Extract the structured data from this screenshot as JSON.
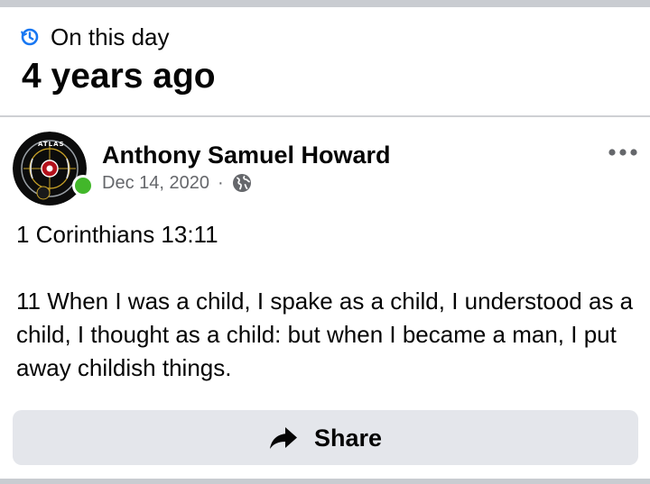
{
  "memory": {
    "label": "On this day",
    "years_ago": "4 years ago"
  },
  "post": {
    "author": "Anthony Samuel Howard",
    "date": "Dec 14, 2020",
    "separator": "·",
    "privacy_icon": "globe-icon",
    "online_status_color": "#42b72a",
    "avatar_text": "ATLAS",
    "body_lines": [
      "1 Corinthians 13:11",
      "",
      "11 When I was a child, I spake as a child, I understood as a child, I thought as a child: but when I became a man, I put away childish things."
    ]
  },
  "actions": {
    "more_icon": "more-options-icon",
    "share_label": "Share",
    "share_icon": "share-arrow-icon"
  },
  "colors": {
    "accent_blue": "#1877f2",
    "secondary_text": "#65676b",
    "button_bg": "#e4e6eb",
    "divider": "#ced0d4"
  }
}
